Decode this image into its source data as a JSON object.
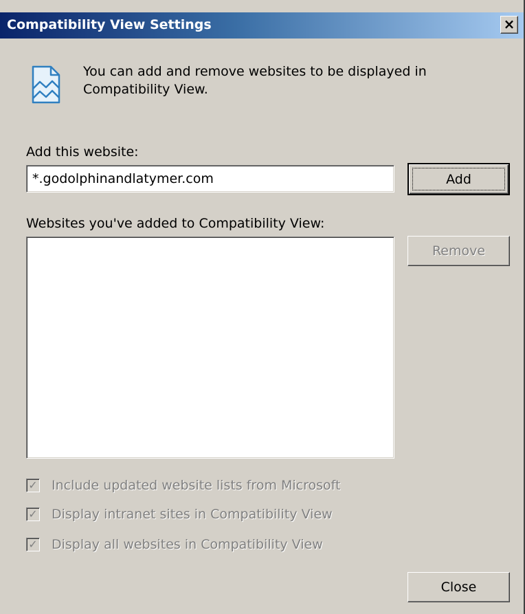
{
  "dialog": {
    "title": "Compatibility View Settings",
    "close_glyph": "×"
  },
  "intro": {
    "icon": "compatibility-view-icon",
    "text": "You can add and remove websites to be displayed in Compatibility View."
  },
  "add_section": {
    "label": "Add this website:",
    "input_value": "*.godolphinandlatymer.com",
    "add_button": "Add"
  },
  "list_section": {
    "label": "Websites you've added to Compatibility View:",
    "items": [],
    "remove_button": "Remove"
  },
  "options": [
    {
      "label": "Include updated website lists from Microsoft",
      "checked": true,
      "enabled": false
    },
    {
      "label": "Display intranet sites in Compatibility View",
      "checked": true,
      "enabled": false
    },
    {
      "label": "Display all websites in Compatibility View",
      "checked": true,
      "enabled": false
    }
  ],
  "footer": {
    "close_button": "Close"
  },
  "colors": {
    "titlebar_start": "#0a246a",
    "titlebar_end": "#a6caf0",
    "dialog_face": "#d4d0c8",
    "disabled_text": "#808080"
  }
}
